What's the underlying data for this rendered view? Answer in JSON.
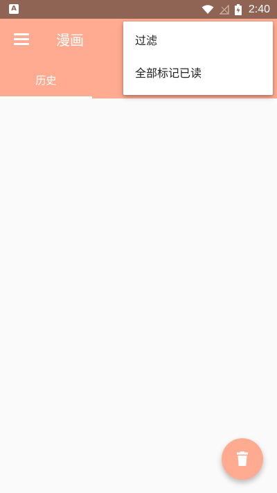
{
  "status_bar": {
    "app_icon_letter": "A",
    "time": "2:40",
    "icons": [
      "wifi-icon",
      "signal-off-icon",
      "battery-charging-icon"
    ]
  },
  "toolbar": {
    "title": "漫画",
    "background_color": "#ffab91"
  },
  "tabs": [
    {
      "label": "历史",
      "selected": true
    }
  ],
  "overflow_menu": {
    "items": [
      {
        "label": "过滤"
      },
      {
        "label": "全部标记已读"
      }
    ]
  },
  "fab": {
    "icon": "delete-icon",
    "color": "#ffab91"
  }
}
